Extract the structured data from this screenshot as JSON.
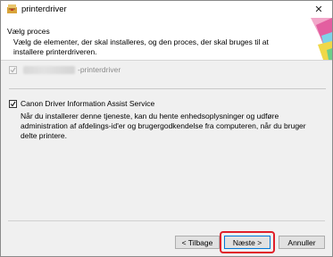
{
  "window": {
    "title": "printerdriver",
    "close_symbol": "✕"
  },
  "header": {
    "title": "Vælg proces",
    "description": "Vælg de elementer, der skal installeres, og den proces, der skal bruges til at installere printerdriveren."
  },
  "options": {
    "printer_driver": {
      "label_suffix": "-printerdriver",
      "checked": true,
      "enabled": false
    },
    "assist_service": {
      "label": "Canon Driver Information Assist Service",
      "checked": true,
      "description": "Når du installerer denne tjeneste, kan du hente enhedsoplysninger og udføre administration af afdelings-id'er og brugergodkendelse fra computeren, når du bruger delte printere."
    }
  },
  "buttons": {
    "back": "< Tilbage",
    "next": "Næste >",
    "cancel": "Annuller"
  },
  "colors": {
    "highlight": "#e0202a",
    "content_bg": "#f0f0f0",
    "default_button_border": "#0078d7"
  }
}
